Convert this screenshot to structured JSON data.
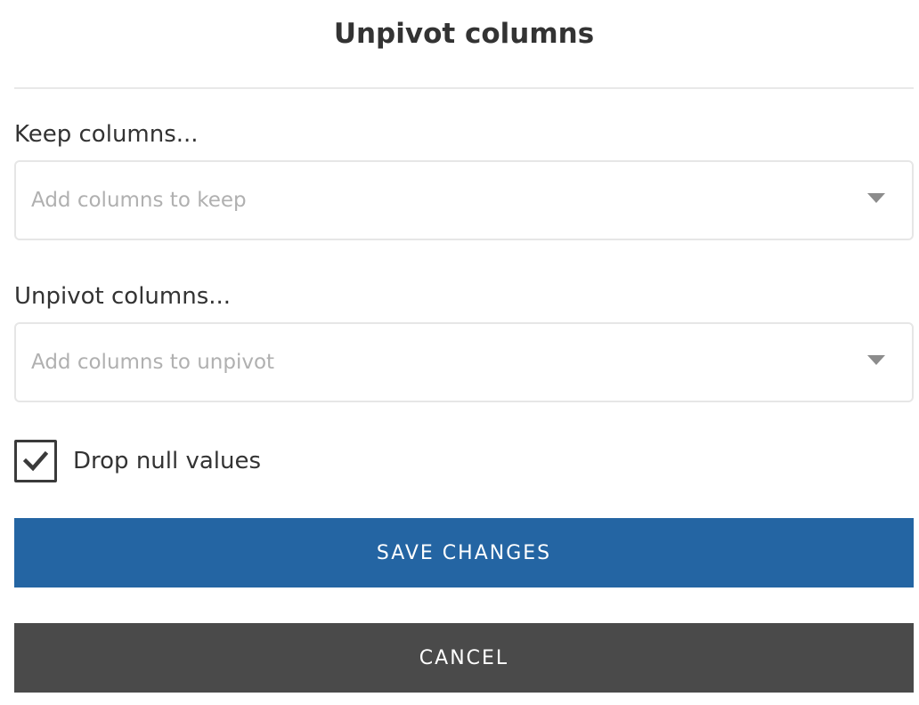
{
  "dialog": {
    "title": "Unpivot columns"
  },
  "keep": {
    "label": "Keep columns...",
    "placeholder": "Add columns to keep",
    "caret_icon": "chevron-down-icon"
  },
  "unpivot": {
    "label": "Unpivot columns...",
    "placeholder": "Add columns to unpivot",
    "caret_icon": "chevron-down-icon"
  },
  "drop_null": {
    "label": "Drop null values",
    "checked": true,
    "icon": "checkmark-icon"
  },
  "buttons": {
    "save_label": "SAVE CHANGES",
    "cancel_label": "CANCEL"
  },
  "colors": {
    "save_button": "#2465a3",
    "cancel_button": "#4a4a4a",
    "text": "#333333",
    "placeholder": "#b0b0b0"
  }
}
